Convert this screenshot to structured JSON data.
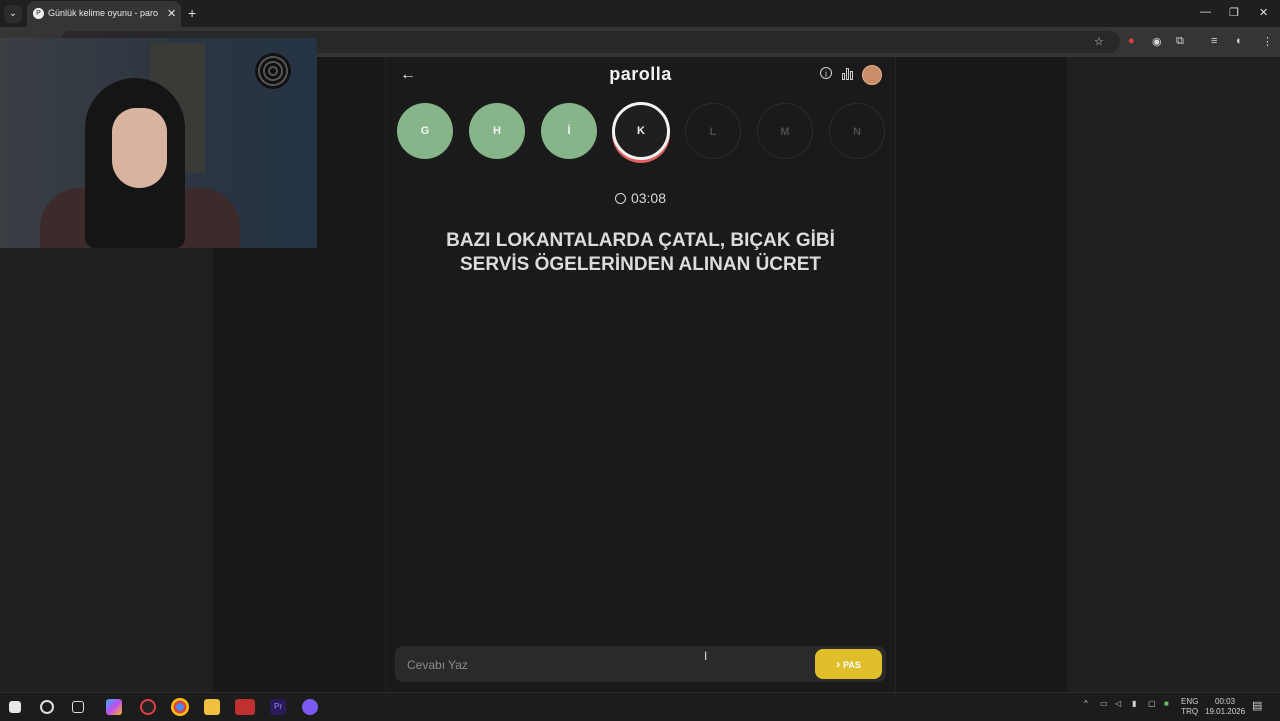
{
  "browser": {
    "tab_title": "Günlük kelime oyunu - parolla",
    "tab_favicon": "P",
    "tab_close": "✕",
    "new_tab": "+",
    "search_tabs_icon": "chevron-down-icon",
    "window_controls": {
      "minimize": "—",
      "restore": "❐",
      "close": "✕"
    },
    "toolbar_icons": [
      "bookmark-star-icon",
      "extension-icon",
      "extension-icon",
      "puzzle-icon",
      "media-icon",
      "profile-icon",
      "menu-icon"
    ]
  },
  "game": {
    "back": "←",
    "logo": "parolla",
    "info_icon": "i",
    "letters": [
      {
        "char": "G",
        "state": "done"
      },
      {
        "char": "H",
        "state": "done"
      },
      {
        "char": "İ",
        "state": "done"
      },
      {
        "char": "K",
        "state": "current"
      },
      {
        "char": "L",
        "state": "todo"
      },
      {
        "char": "M",
        "state": "todo"
      },
      {
        "char": "N",
        "state": "todo"
      }
    ],
    "timer": "03:08",
    "question": "BAZI LOKANTALARDA ÇATAL, BIÇAK GİBİ SERVİS ÖGELERİNDEN ALINAN ÜCRET",
    "answer_placeholder": "Cevabı Yaz",
    "answer_value": "",
    "pass_button": "PAS",
    "pass_chevron": "›",
    "colors": {
      "done": "#86b58a",
      "current_ring": "#f2f2f2",
      "current_underline": "#e06060",
      "pass": "#e0be2c"
    }
  },
  "taskbar": {
    "lang_top": "ENG",
    "lang_bottom": "TRQ",
    "time": "00:03",
    "date": "19.01.2026"
  }
}
